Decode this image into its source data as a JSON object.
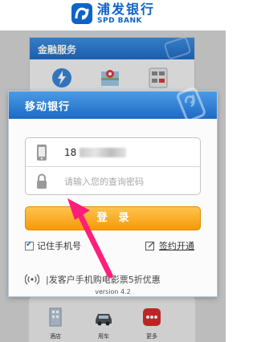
{
  "brand": {
    "name_cn": "浦发银行",
    "name_en": "SPD BANK"
  },
  "financial_panel": {
    "title": "金融服务"
  },
  "tabbar": {
    "items": [
      {
        "label": "酒店",
        "icon": "hotel-icon"
      },
      {
        "label": "用车",
        "icon": "car-icon"
      },
      {
        "label": "更多",
        "icon": "more-icon"
      }
    ]
  },
  "login": {
    "title": "移动银行",
    "phone_value": "18",
    "password_placeholder": "请输入您的查询密码",
    "login_label": "登录",
    "remember_label": "记住手机号",
    "signup_label": "签约开通",
    "promo_text": "|发客户手机购电影票5折优惠",
    "version": "version 4.2"
  },
  "colors": {
    "brand_blue": "#0d63c9",
    "header_blue": "#1d6ac4",
    "login_orange": "#f59b08",
    "arrow_pink": "#ff1f7a"
  },
  "annotation": {
    "type": "arrow",
    "icon": "red-arrow-icon"
  }
}
